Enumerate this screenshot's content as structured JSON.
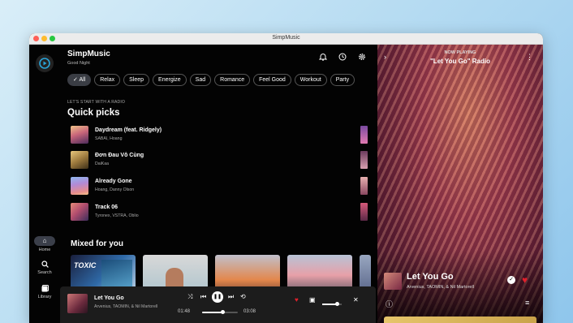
{
  "window": {
    "title": "SimpMusic"
  },
  "sidebar": {
    "items": [
      {
        "label": "Home",
        "icon": "home-icon"
      },
      {
        "label": "Search",
        "icon": "search-icon"
      },
      {
        "label": "Library",
        "icon": "library-icon"
      }
    ]
  },
  "header": {
    "app_name": "SimpMusic",
    "greeting": "Good Night"
  },
  "chips": [
    "All",
    "Relax",
    "Sleep",
    "Energize",
    "Sad",
    "Romance",
    "Feel Good",
    "Workout",
    "Party"
  ],
  "quick_picks": {
    "label": "LET'S START WITH A RADIO",
    "title": "Quick picks",
    "items": [
      {
        "title": "Daydream (feat. Ridgely)",
        "artist": "SABAI, Hoang"
      },
      {
        "title": "Đơn Đau Vô Cùng",
        "artist": "DaiKaa"
      },
      {
        "title": "Already Gone",
        "artist": "Hoang, Danny Olson"
      },
      {
        "title": "Track 06",
        "artist": "Tyronex, VSTRA, Oblio"
      }
    ]
  },
  "mixed_for_you": {
    "title": "Mixed for you",
    "first_card_text": "TOXIC"
  },
  "player": {
    "title": "Let You Go",
    "artist": "Arvenius, TAOMIN, & Nil Martorell",
    "elapsed": "01:48",
    "duration": "03:08",
    "progress": 0.57,
    "volume": 0.75
  },
  "now_playing": {
    "label": "NOW PLAYING",
    "playlist": "\"Let You Go\" Radio",
    "song": "Let You Go",
    "artist": "Arvenius, TAOMIN, & Nil Martorell"
  },
  "colors": {
    "accent": "#2aa4d8",
    "heart": "#e0202c",
    "chip_active": "#3a3d44"
  }
}
